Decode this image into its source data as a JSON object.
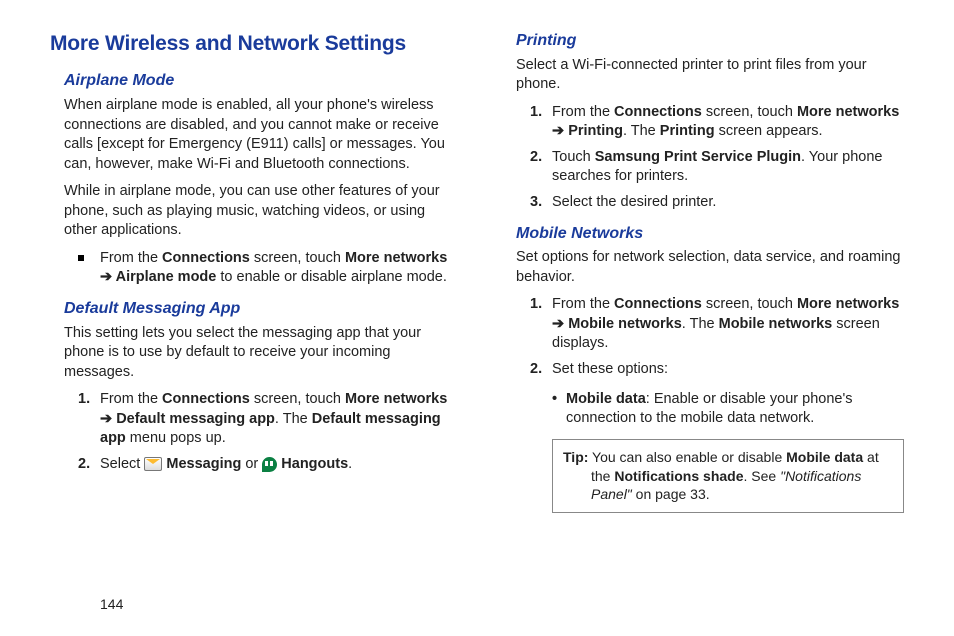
{
  "pageNumber": "144",
  "h1": "More Wireless and Network Settings",
  "left": {
    "airplane": {
      "heading": "Airplane Mode",
      "p1": "When airplane mode is enabled, all your phone's wireless connections are disabled, and you cannot make or receive calls [except for Emergency (E911) calls] or messages. You can, however, make Wi-Fi and Bluetooth connections.",
      "p2": "While in airplane mode, you can use other features of your phone, such as playing music, watching videos, or using other applications.",
      "bullet_pre": "From the ",
      "bullet_b1": "Connections",
      "bullet_mid1": " screen, touch ",
      "bullet_b2": "More networks",
      "bullet_arrow": " ➔ ",
      "bullet_b3": "Airplane mode",
      "bullet_post": " to enable or disable airplane mode."
    },
    "msg": {
      "heading": "Default Messaging App",
      "p1": "This setting lets you select the messaging app that your phone is to use by default to receive your incoming messages.",
      "s1_pre": "From the ",
      "s1_b1": "Connections",
      "s1_mid1": " screen, touch ",
      "s1_b2": "More networks",
      "s1_arrow": " ➔ ",
      "s1_b3": "Default messaging app",
      "s1_mid2": ". The ",
      "s1_b4": "Default messaging app",
      "s1_post": " menu pops up.",
      "s2_pre": "Select ",
      "s2_b1": " Messaging",
      "s2_mid": " or ",
      "s2_b2": " Hangouts",
      "s2_post": "."
    }
  },
  "right": {
    "print": {
      "heading": "Printing",
      "p1": "Select a Wi-Fi-connected printer to print files from your phone.",
      "s1_pre": "From the ",
      "s1_b1": "Connections",
      "s1_mid1": " screen, touch ",
      "s1_b2": "More networks",
      "s1_arrow": " ➔ ",
      "s1_b3": "Printing",
      "s1_mid2": ". The ",
      "s1_b4": "Printing",
      "s1_post": " screen appears.",
      "s2_pre": "Touch ",
      "s2_b1": "Samsung Print Service Plugin",
      "s2_post": ". Your phone searches for printers.",
      "s3": "Select the desired printer."
    },
    "mobile": {
      "heading": "Mobile Networks",
      "p1": "Set options for network selection, data service, and roaming behavior.",
      "s1_pre": "From the ",
      "s1_b1": "Connections",
      "s1_mid1": " screen, touch ",
      "s1_b2": "More networks",
      "s1_arrow": " ➔ ",
      "s1_b3": "Mobile networks",
      "s1_mid2": ". The ",
      "s1_b4": "Mobile networks",
      "s1_post": " screen displays.",
      "s2": "Set these options:",
      "opt_b": "Mobile data",
      "opt_post": ": Enable or disable your phone's connection to the mobile data network.",
      "tip_b1": "Tip:",
      "tip_t1": " You can also enable or disable ",
      "tip_b2": "Mobile data",
      "tip_t2": " at ",
      "tip_t3": "the ",
      "tip_b3": "Notifications shade",
      "tip_t4": ". See ",
      "tip_ref": "\"Notifications Panel\"",
      "tip_t5": " on page 33."
    }
  }
}
